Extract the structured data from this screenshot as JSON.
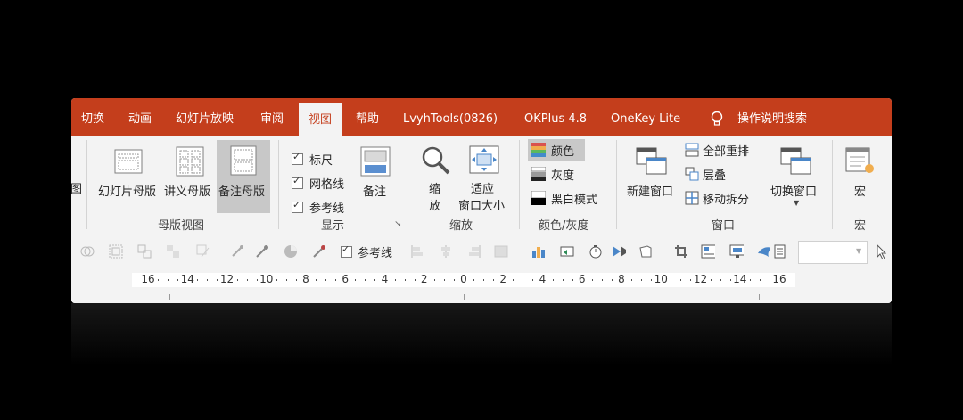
{
  "tabs": [
    "切换",
    "动画",
    "幻灯片放映",
    "审阅",
    "视图",
    "帮助",
    "LvyhTools(0826)",
    "OKPlus 4.8",
    "OneKey Lite",
    "操作说明搜索"
  ],
  "active_tab": "视图",
  "ribbon": {
    "partial_left": "图",
    "master_views": {
      "group_label": "母版视图",
      "slide_master": "幻灯片母版",
      "handout_master": "讲义母版",
      "notes_master": "备注母版"
    },
    "show": {
      "group_label": "显示",
      "ruler": "标尺",
      "gridlines": "网格线",
      "guides": "参考线",
      "notes": "备注"
    },
    "zoom": {
      "group_label": "缩放",
      "zoom_line1": "缩",
      "zoom_line2": "放",
      "fit_line1": "适应",
      "fit_line2": "窗口大小"
    },
    "color": {
      "group_label": "颜色/灰度",
      "color": "颜色",
      "grayscale": "灰度",
      "black_white": "黑白模式"
    },
    "window": {
      "group_label": "窗口",
      "new_window": "新建窗口",
      "arrange_all": "全部重排",
      "cascade": "层叠",
      "move_split": "移动拆分",
      "switch_windows": "切换窗口"
    },
    "macros": {
      "group_label": "宏",
      "macros": "宏"
    }
  },
  "qat": {
    "guides_label": "参考线"
  },
  "ruler": {
    "labels": [
      "16",
      "14",
      "12",
      "10",
      "8",
      "6",
      "4",
      "2",
      "0",
      "2",
      "4",
      "6",
      "8",
      "10",
      "12",
      "14",
      "16"
    ]
  },
  "colors": {
    "accent": "#c43e1c",
    "ribbon_bg": "#f3f3f3",
    "selected_bg": "#c8c8c8"
  }
}
